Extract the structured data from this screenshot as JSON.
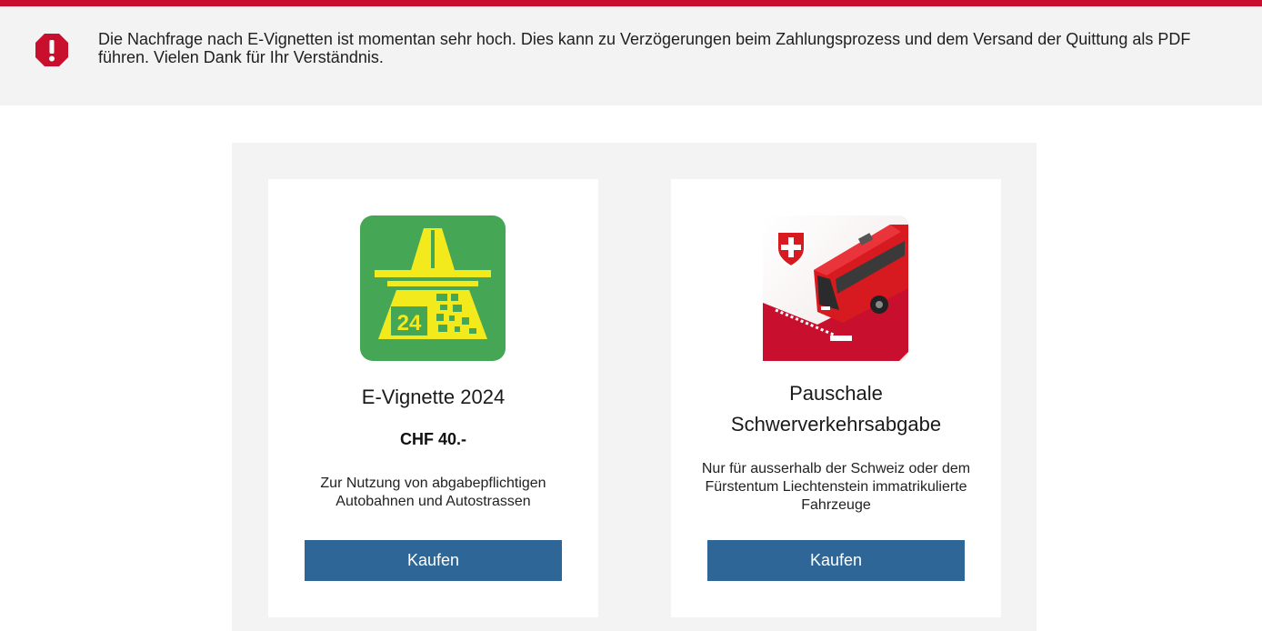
{
  "notice": {
    "icon": "warning-octagon-icon",
    "text": "Die Nachfrage nach E-Vignetten ist momentan sehr hoch. Dies kann zu Verzögerungen beim Zahlungsprozess und dem Versand der Quittung als PDF führen. Vielen Dank für Ihr Verständnis."
  },
  "products": [
    {
      "image": "e-vignette-2024-icon",
      "image_label": "24",
      "title": "E-Vignette 2024",
      "price": "CHF 40.-",
      "description": "Zur Nutzung von abgabepflichtigen Autobahnen und Autostrassen",
      "button_label": "Kaufen"
    },
    {
      "image": "red-bus-swiss-shield-icon",
      "title": "Pauschale Schwerverkehrsabgabe",
      "description": "Nur für ausserhalb der Schweiz oder dem Fürstentum Liechtenstein immatrikulierte Fahrzeuge",
      "button_label": "Kaufen"
    }
  ],
  "colors": {
    "brand_red": "#c8102e",
    "button_blue": "#2e6797",
    "vignette_green": "#45a756",
    "vignette_yellow": "#f2ea1d"
  }
}
